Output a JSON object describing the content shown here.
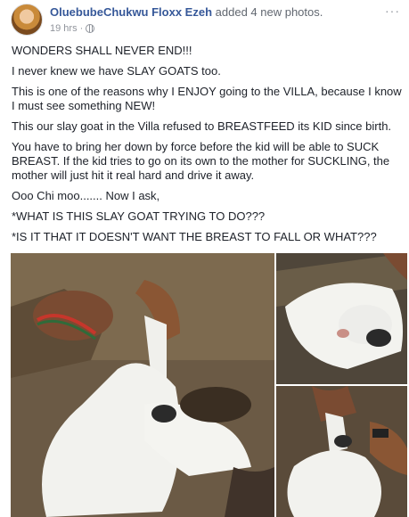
{
  "post": {
    "author": "OluebubeChukwu Floxx Ezeh",
    "action": "added 4 new photos.",
    "time": "19 hrs",
    "separator": "·",
    "privacy_icon": "globe-icon",
    "more_icon": "more-options-icon",
    "more_glyph": "···"
  },
  "paragraphs": [
    "WONDERS SHALL NEVER END!!!",
    "I never knew we have SLAY GOATS too.",
    "This is one of the reasons why I ENJOY going to the VILLA, because I know I must see something NEW!",
    "This our slay goat in the Villa refused to BREASTFEED its KID since birth.",
    "You have to bring her down by force before the kid will be able to SUCK BREAST. If the kid tries to go on its own to the mother for SUCKLING, the mother will just hit it real hard and drive it away.",
    "Ooo Chi moo....... Now I ask,",
    "*WHAT IS THIS SLAY GOAT TRYING TO DO???",
    "*IS IT THAT IT DOESN'T WANT THE BREAST TO FALL OR WHAT???"
  ],
  "colors": {
    "link": "#365899",
    "secondary": "#616770",
    "meta": "#90949c",
    "text": "#1d2129"
  }
}
